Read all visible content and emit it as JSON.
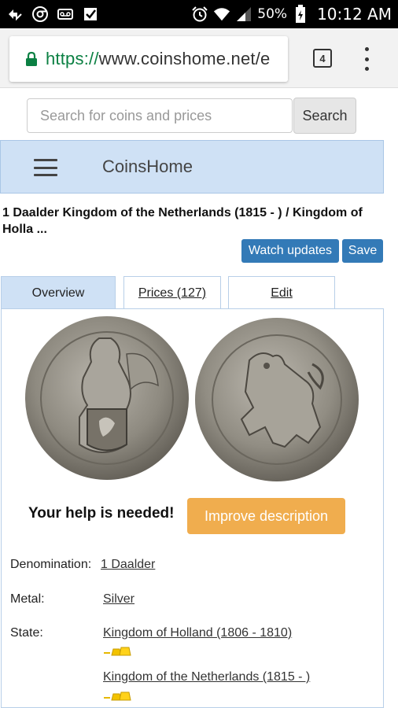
{
  "status_bar": {
    "battery_percent": "50%",
    "time": "10:12 AM"
  },
  "browser": {
    "url_scheme": "https://",
    "url_rest": "www.coinshome.net/e",
    "tab_count": "4"
  },
  "search": {
    "placeholder": "Search for coins and prices",
    "button_label": "Search"
  },
  "header": {
    "brand": "CoinsHome"
  },
  "page": {
    "title": "1 Daalder Kingdom of the Netherlands (1815 - ) / Kingdom of Holla ...",
    "watch_label": "Watch updates",
    "save_label": "Save"
  },
  "tabs": [
    {
      "label": "Overview",
      "active": true
    },
    {
      "label": "Prices (127)",
      "active": false
    },
    {
      "label": "Edit",
      "active": false
    }
  ],
  "help": {
    "text": "Your help is needed!",
    "button_label": "Improve description"
  },
  "details": {
    "denomination_label": "Denomination:",
    "denomination_value": "1 Daalder",
    "metal_label": "Metal:",
    "metal_value": "Silver",
    "state_label": "State:",
    "states": [
      "Kingdom of Holland (1806 - 1810)",
      "Kingdom of the Netherlands (1815 - )"
    ]
  },
  "colors": {
    "header_bg": "#cfe1f5",
    "primary_button": "#337ab7",
    "warning_button": "#f0ad4e",
    "url_green": "#0b8043"
  },
  "icons": [
    "sync-icon",
    "chrome-icon",
    "voicemail-icon",
    "check-icon",
    "alarm-icon",
    "wifi-icon",
    "signal-icon",
    "battery-icon",
    "lock-icon",
    "gold-bars-icon"
  ]
}
